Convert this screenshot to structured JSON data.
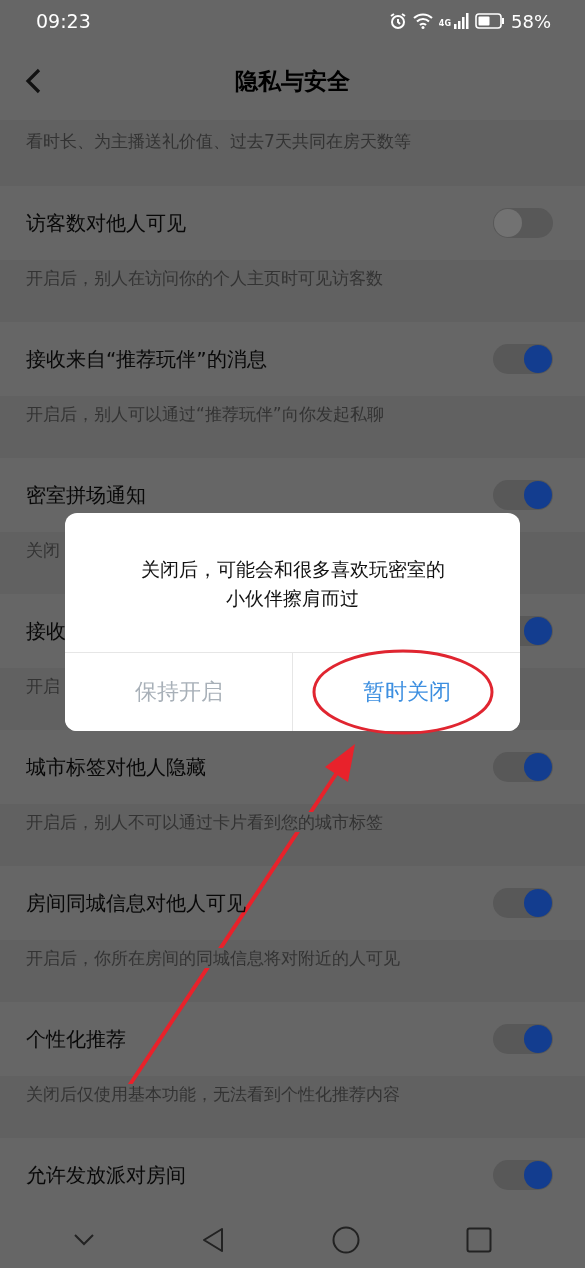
{
  "status_bar": {
    "time": "09:23",
    "network": "4G",
    "battery": "58%"
  },
  "header": {
    "title": "隐私与安全"
  },
  "top_note": "看时长、为主播送礼价值、过去7天共同在房天数等",
  "settings": [
    {
      "title": "访客数对他人可见",
      "description": "开启后，别人在访问你的个人主页时可见访客数",
      "on": false
    },
    {
      "title": "接收来自“推荐玩伴”的消息",
      "description": "开启后，别人可以通过“推荐玩伴”向你发起私聊",
      "on": true
    },
    {
      "title": "密室拼场通知",
      "description": "关闭",
      "on": true
    },
    {
      "title": "接收",
      "description": "开启",
      "on": true
    },
    {
      "title": "城市标签对他人隐藏",
      "description": "开启后，别人不可以通过卡片看到您的城市标签",
      "on": true
    },
    {
      "title": "房间同城信息对他人可见",
      "description": "开启后，你所在房间的同城信息将对附近的人可见",
      "on": true
    },
    {
      "title": "个性化推荐",
      "description": "关闭后仅使用基本功能，无法看到个性化推荐内容",
      "on": true
    },
    {
      "title": "允许发放派对房间",
      "on": true
    }
  ],
  "dialog": {
    "message": "关闭后，可能会和很多喜欢玩密室的小伙伴擦肩而过",
    "buttons": [
      {
        "label": "保持开启",
        "kind": "secondary",
        "highlighted": false
      },
      {
        "label": "暂时关闭",
        "kind": "primary",
        "highlighted": true
      }
    ]
  }
}
